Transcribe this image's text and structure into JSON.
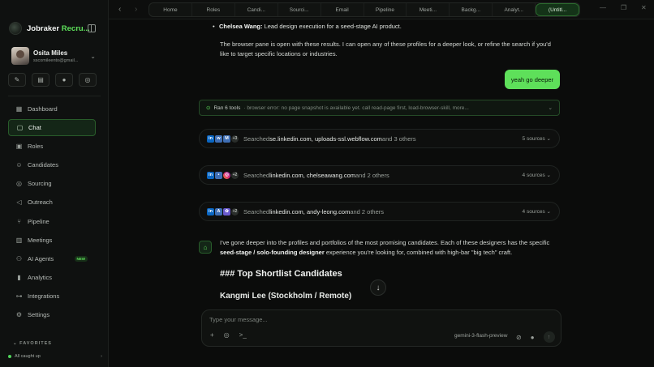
{
  "app": {
    "brand_prefix": "Jobraker ",
    "brand_accent": "Recru..."
  },
  "user": {
    "name": "Osita Miles",
    "email": "sscomileento@gmail..."
  },
  "sidebar": {
    "items": [
      {
        "label": "Dashboard",
        "icon": "grid-icon"
      },
      {
        "label": "Chat",
        "icon": "chat-icon"
      },
      {
        "label": "Roles",
        "icon": "briefcase-icon"
      },
      {
        "label": "Candidates",
        "icon": "users-icon"
      },
      {
        "label": "Sourcing",
        "icon": "target-icon"
      },
      {
        "label": "Outreach",
        "icon": "megaphone-icon"
      },
      {
        "label": "Pipeline",
        "icon": "pipeline-icon"
      },
      {
        "label": "Meetings",
        "icon": "calendar-icon"
      },
      {
        "label": "AI Agents",
        "icon": "robot-icon",
        "badge": "NEW"
      },
      {
        "label": "Analytics",
        "icon": "chart-icon"
      },
      {
        "label": "Integrations",
        "icon": "plug-icon"
      },
      {
        "label": "Settings",
        "icon": "gear-icon"
      }
    ],
    "favorites_label": "FAVORITES",
    "status_text": "All caught up"
  },
  "tabs": [
    "Home",
    "Roles",
    "Candi...",
    "Sourci...",
    "Email",
    "Pipeline",
    "Meeti...",
    "Backg...",
    "Analyt...",
    "(Untitl..."
  ],
  "messages": {
    "bullet_name": "Chelsea Wang:",
    "bullet_text": " Lead design execution for a seed-stage AI product.",
    "para": "The browser pane is open with these results. I can open any of these profiles for a deeper look, or refine the search if you'd like to target specific locations or industries.",
    "user_reply": "yeah go deeper",
    "tools_label": "Ran 6 tools",
    "tools_detail": "· browser error: no page snapshot is available yet. call read-page first, load-browser-skill, more...",
    "searches": [
      {
        "more_count": "+3",
        "prefix": "Searched ",
        "domains": "se.linkedin.com, uploads-ssl.webflow.com",
        "suffix": " and 3 others",
        "sources": "5 sources"
      },
      {
        "more_count": "+2",
        "prefix": "Searched ",
        "domains": "linkedin.com, chelseawang.com",
        "suffix": " and 2 others",
        "sources": "4 sources"
      },
      {
        "more_count": "+2",
        "prefix": "Searched ",
        "domains": "linkedin.com, andy-leong.com",
        "suffix": " and 2 others",
        "sources": "4 sources"
      }
    ],
    "assistant_p1": "I've gone deeper into the profiles and portfolios of the most promising candidates. Each of these designers has the specific ",
    "assistant_bold": "seed-stage / solo-founding designer",
    "assistant_p2": " experience you're looking for, combined with high-bar \"big tech\" craft.",
    "heading": "### Top Shortlist Candidates",
    "subheading": "Kangmi Lee (Stockholm / Remote)"
  },
  "composer": {
    "placeholder": "Type your message...",
    "model": "gemini-3-flash-preview"
  }
}
